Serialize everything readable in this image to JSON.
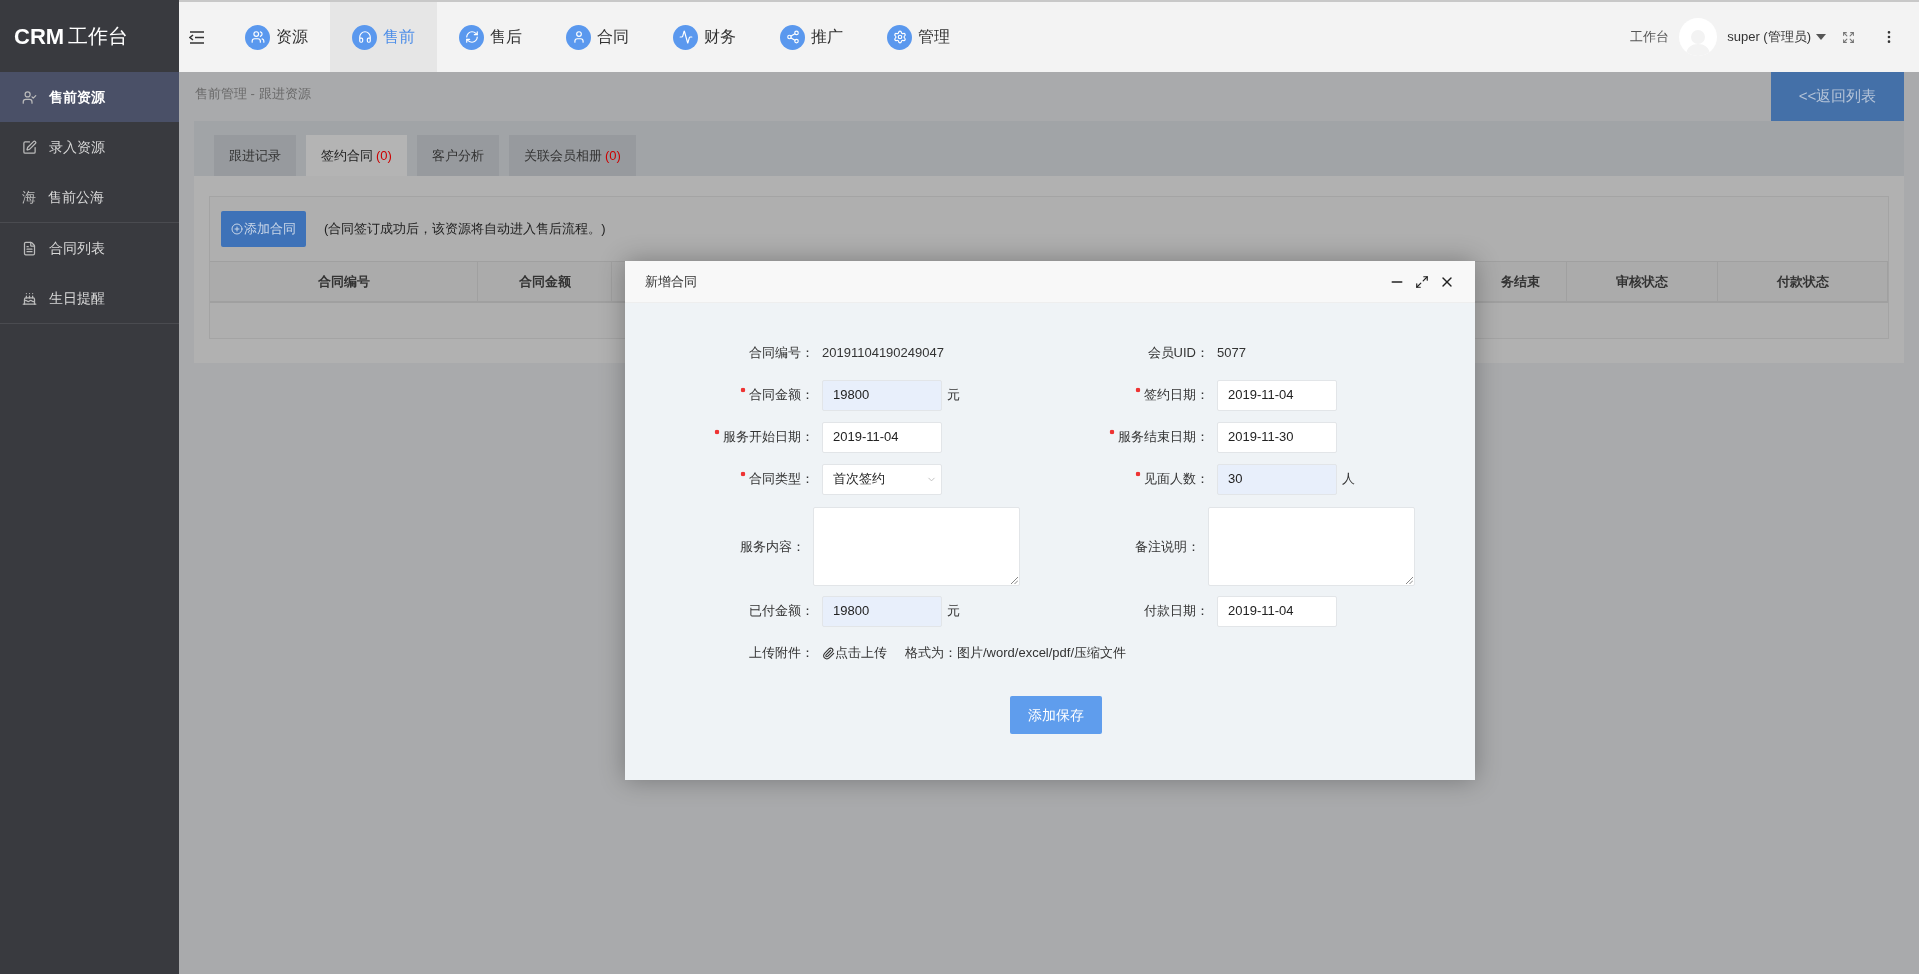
{
  "sidebar": {
    "logo_bold": "CRM",
    "logo_text": "工作台",
    "groups": [
      [
        {
          "label": "售前资源",
          "selected": true
        },
        {
          "label": "录入资源",
          "selected": false
        },
        {
          "label": "售前公海",
          "selected": false,
          "glyph": "海"
        }
      ],
      [
        {
          "label": "合同列表",
          "selected": false
        },
        {
          "label": "生日提醒",
          "selected": false
        }
      ]
    ]
  },
  "nav": {
    "items": [
      {
        "label": "资源",
        "selected": false
      },
      {
        "label": "售前",
        "selected": true
      },
      {
        "label": "售后",
        "selected": false
      },
      {
        "label": "合同",
        "selected": false
      },
      {
        "label": "财务",
        "selected": false
      },
      {
        "label": "推广",
        "selected": false
      },
      {
        "label": "管理",
        "selected": false
      }
    ]
  },
  "user": {
    "workbench": "工作台",
    "name": "super (管理员)"
  },
  "breadcrumb": "售前管理 - 跟进资源",
  "back_button": "<<返回列表",
  "tabs": [
    {
      "label": "跟进记录",
      "selected": false
    },
    {
      "label": "签约合同",
      "count": "(0)",
      "selected": true
    },
    {
      "label": "客户分析",
      "selected": false
    },
    {
      "label": "关联会员相册",
      "count": "(0)",
      "selected": false
    }
  ],
  "add_button": "添加合同",
  "notice": "(合同签订成功后，该资源将自动进入售后流程。)",
  "table": {
    "columns": [
      "合同编号",
      "合同金额",
      "务结束",
      "审核状态",
      "付款状态"
    ]
  },
  "modal": {
    "title": "新增合同",
    "rows": [
      [
        {
          "kind": "static",
          "label": "合同编号：",
          "value": "20191104190249047",
          "required": false
        },
        {
          "kind": "static",
          "label": "会员UID：",
          "value": "5077",
          "required": false
        }
      ],
      [
        {
          "kind": "input",
          "label": "合同金额：",
          "value": "19800",
          "required": true,
          "highlighted": true,
          "unit": "元"
        },
        {
          "kind": "input",
          "label": "签约日期：",
          "value": "2019-11-04",
          "required": true,
          "highlighted": false
        }
      ],
      [
        {
          "kind": "input",
          "label": "服务开始日期：",
          "value": "2019-11-04",
          "required": true,
          "highlighted": false
        },
        {
          "kind": "input",
          "label": "服务结束日期：",
          "value": "2019-11-30",
          "required": true,
          "highlighted": false
        }
      ],
      [
        {
          "kind": "select",
          "label": "合同类型：",
          "value": "首次签约",
          "required": true,
          "highlighted": false
        },
        {
          "kind": "input",
          "label": "见面人数：",
          "value": "30",
          "required": true,
          "highlighted": true,
          "unit": "人"
        }
      ],
      [
        {
          "kind": "textarea",
          "label": "服务内容：",
          "required": false
        },
        {
          "kind": "textarea",
          "label": "备注说明：",
          "required": false
        }
      ],
      [
        {
          "kind": "input",
          "label": "已付金额：",
          "value": "19800",
          "required": false,
          "highlighted": true,
          "unit": "元"
        },
        {
          "kind": "input",
          "label": "付款日期：",
          "value": "2019-11-04",
          "required": false,
          "highlighted": false
        }
      ],
      [
        {
          "kind": "upload",
          "label": "上传附件：",
          "link": "点击上传",
          "hint": "格式为：图片/word/excel/pdf/压缩文件",
          "required": false
        }
      ]
    ],
    "submit": "添加保存"
  }
}
